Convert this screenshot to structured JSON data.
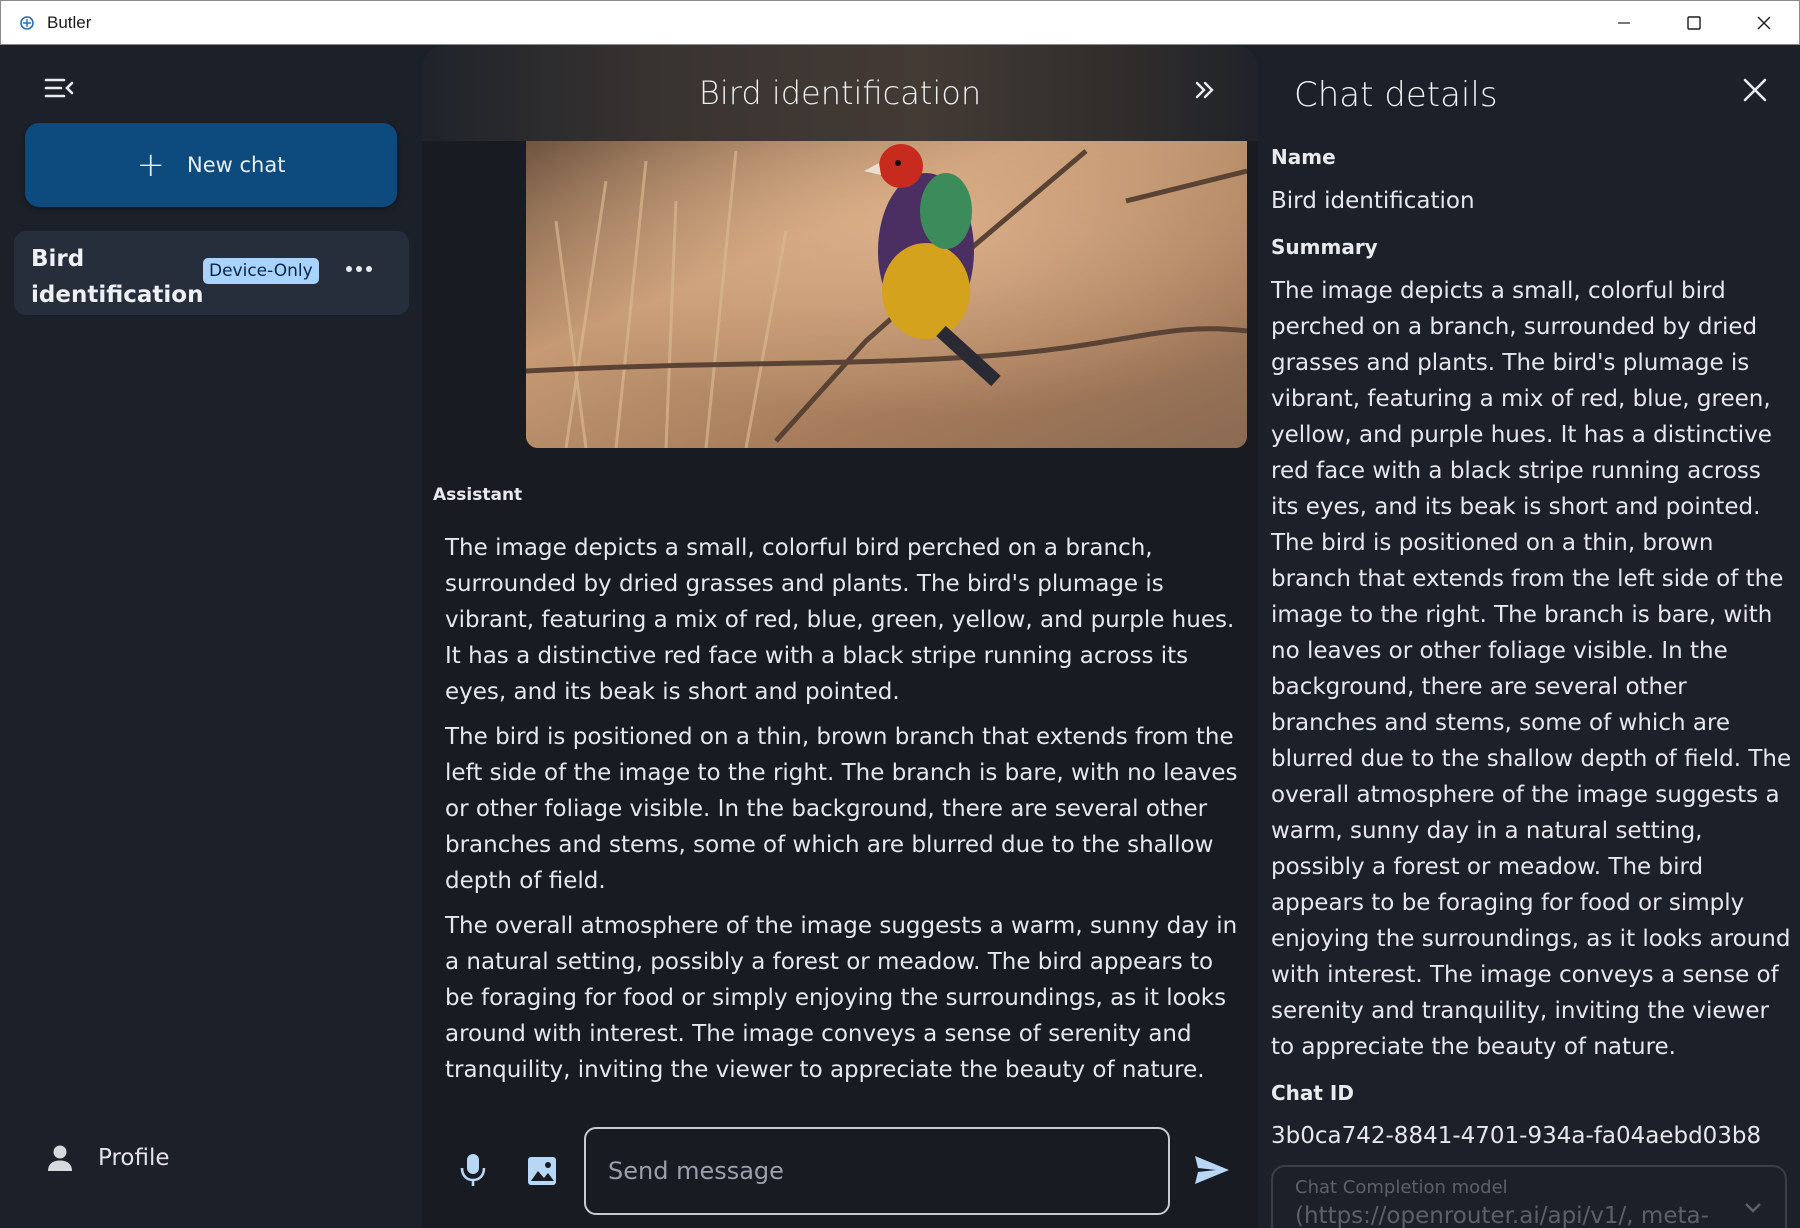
{
  "window": {
    "title": "Butler"
  },
  "sidebar": {
    "new_chat_label": "New chat",
    "chats": [
      {
        "title": "Bird identification",
        "badge": "Device-Only"
      }
    ],
    "profile_label": "Profile"
  },
  "main": {
    "title": "Bird identification",
    "role_label": "Assistant",
    "answer_paragraphs": [
      "The image depicts a small, colorful bird perched on a branch, surrounded by dried grasses and plants. The bird's plumage is vibrant, featuring a mix of red, blue, green, yellow, and purple hues. It has a distinctive red face with a black stripe running across its eyes, and its beak is short and pointed.",
      "The bird is positioned on a thin, brown branch that extends from the left side of the image to the right. The branch is bare, with no leaves or other foliage visible. In the background, there are several other branches and stems, some of which are blurred due to the shallow depth of field.",
      "The overall atmosphere of the image suggests a warm, sunny day in a natural setting, possibly a forest or meadow. The bird appears to be foraging for food or simply enjoying the surroundings, as it looks around with interest. The image conveys a sense of serenity and tranquility, inviting the viewer to appreciate the beauty of nature."
    ],
    "input_placeholder": "Send message"
  },
  "details": {
    "title": "Chat details",
    "name_label": "Name",
    "name_value": "Bird identification",
    "summary_label": "Summary",
    "summary_value": "The image depicts a small, colorful bird perched on a branch, surrounded by dried grasses and plants. The bird's plumage is vibrant, featuring a mix of red, blue, green, yellow, and purple hues. It has a distinctive red face with a black stripe running across its eyes, and its beak is short and pointed. The bird is positioned on a thin, brown branch that extends from the left side of the image to the right. The branch is bare, with no leaves or other foliage visible. In the background, there are several other branches and stems, some of which are blurred due to the shallow depth of field. The overall atmosphere of the image suggests a warm, sunny day in a natural setting, possibly a forest or meadow. The bird appears to be foraging for food or simply enjoying the surroundings, as it looks around with interest. The image conveys a sense of serenity and tranquility, inviting the viewer to appreciate the beauty of nature.",
    "chat_id_label": "Chat ID",
    "chat_id_value": "3b0ca742-8841-4701-934a-fa04aebd03b8",
    "model_label": "Chat Completion model",
    "model_value": "(https://openrouter.ai/api/v1/, meta-"
  },
  "colors": {
    "accent": "#0d4a7d",
    "badge": "#a8d3ff",
    "background": "#1c2129",
    "panel": "#181c22"
  },
  "icons": [
    "app-icon",
    "minimize-icon",
    "maximize-icon",
    "close-icon",
    "sidebar-collapse-icon",
    "plus-icon",
    "more-icon",
    "person-icon",
    "chevrons-right-icon",
    "mic-icon",
    "image-icon",
    "send-icon",
    "close-details-icon",
    "chevron-down-icon"
  ]
}
